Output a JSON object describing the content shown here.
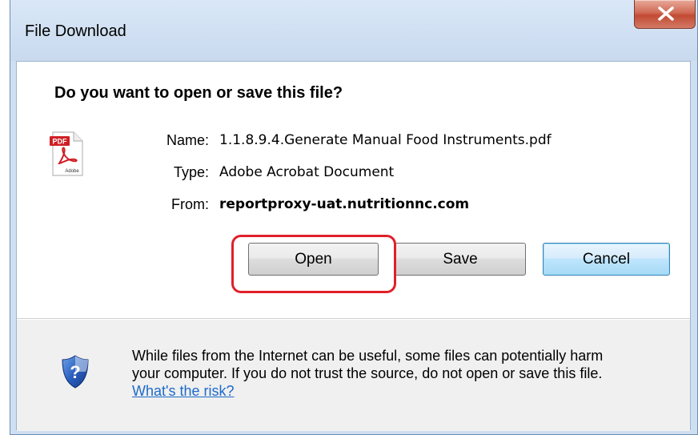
{
  "window": {
    "title": "File Download",
    "close_label": "X"
  },
  "dialog": {
    "question": "Do you want to open or save this file?",
    "file_icon": "pdf-file-icon",
    "file_icon_badge": "PDF",
    "file_icon_caption": "Adobe",
    "name_label": "Name:",
    "name_value": "1.1.8.9.4.Generate Manual Food Instruments.pdf",
    "type_label": "Type:",
    "type_value": "Adobe Acrobat Document",
    "from_label": "From:",
    "from_value": "reportproxy-uat.nutritionnc.com"
  },
  "buttons": {
    "open_label": "Open",
    "save_label": "Save",
    "cancel_label": "Cancel"
  },
  "highlight": {
    "color": "#e0202a",
    "target": "open-button"
  },
  "footer": {
    "icon": "security-shield-icon",
    "warning_line1": "While files from the Internet can be useful, some files can potentially harm",
    "warning_line2": "your computer. If you do not trust the source, do not open or save this file.",
    "risk_link": "What's the risk?"
  }
}
